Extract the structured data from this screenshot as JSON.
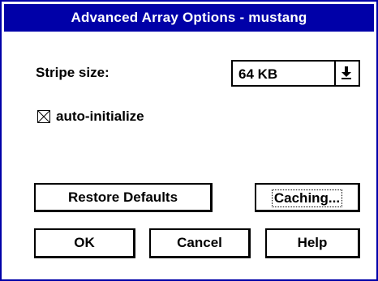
{
  "window": {
    "title": "Advanced Array Options - mustang",
    "accent_color": "#0000a8"
  },
  "stripe": {
    "label": "Stripe size:",
    "value": "64 KB",
    "arrow_icon": "dropdown-arrow-icon"
  },
  "auto_init": {
    "label": "auto-initialize",
    "checked": true,
    "icon": "checkbox-checked-icon"
  },
  "buttons": {
    "restore_defaults": "Restore Defaults",
    "caching": "Caching...",
    "ok": "OK",
    "cancel": "Cancel",
    "help": "Help"
  }
}
